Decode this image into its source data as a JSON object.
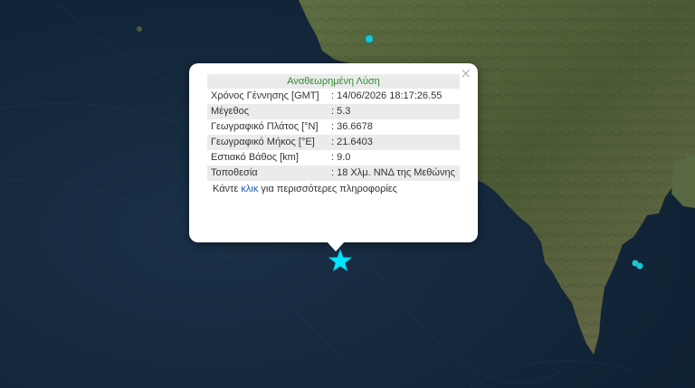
{
  "popup": {
    "title": "Αναθεωρημένη Λύση",
    "close_label": "×",
    "rows": [
      {
        "label": "Χρόνος Γέννησης [GMT]",
        "value": ": 14/06/2026 18:17:26.55"
      },
      {
        "label": "Μέγεθος",
        "value": ": 5.3"
      },
      {
        "label": "Γεωγραφικό Πλάτος [°N]",
        "value": ": 36.6678"
      },
      {
        "label": "Γεωγραφικό Μήκος [°E]",
        "value": ": 21.6403"
      },
      {
        "label": "Εστιακό Βάθος [km]",
        "value": ": 9.0"
      },
      {
        "label": "Τοποθεσία",
        "value": ": 18 Χλμ. ΝΝΔ της Μεθώνης"
      }
    ],
    "more_prefix": "Κάντε ",
    "more_link": "κλικ",
    "more_suffix": " για περισσότερες πληροφορίες"
  },
  "markers": {
    "epicenter_icon": "star-icon",
    "epicenter_color": "#00e5ff",
    "event_color": "#19c6d6"
  },
  "map_colors": {
    "sea": "#14283a",
    "land": "#51613a"
  }
}
